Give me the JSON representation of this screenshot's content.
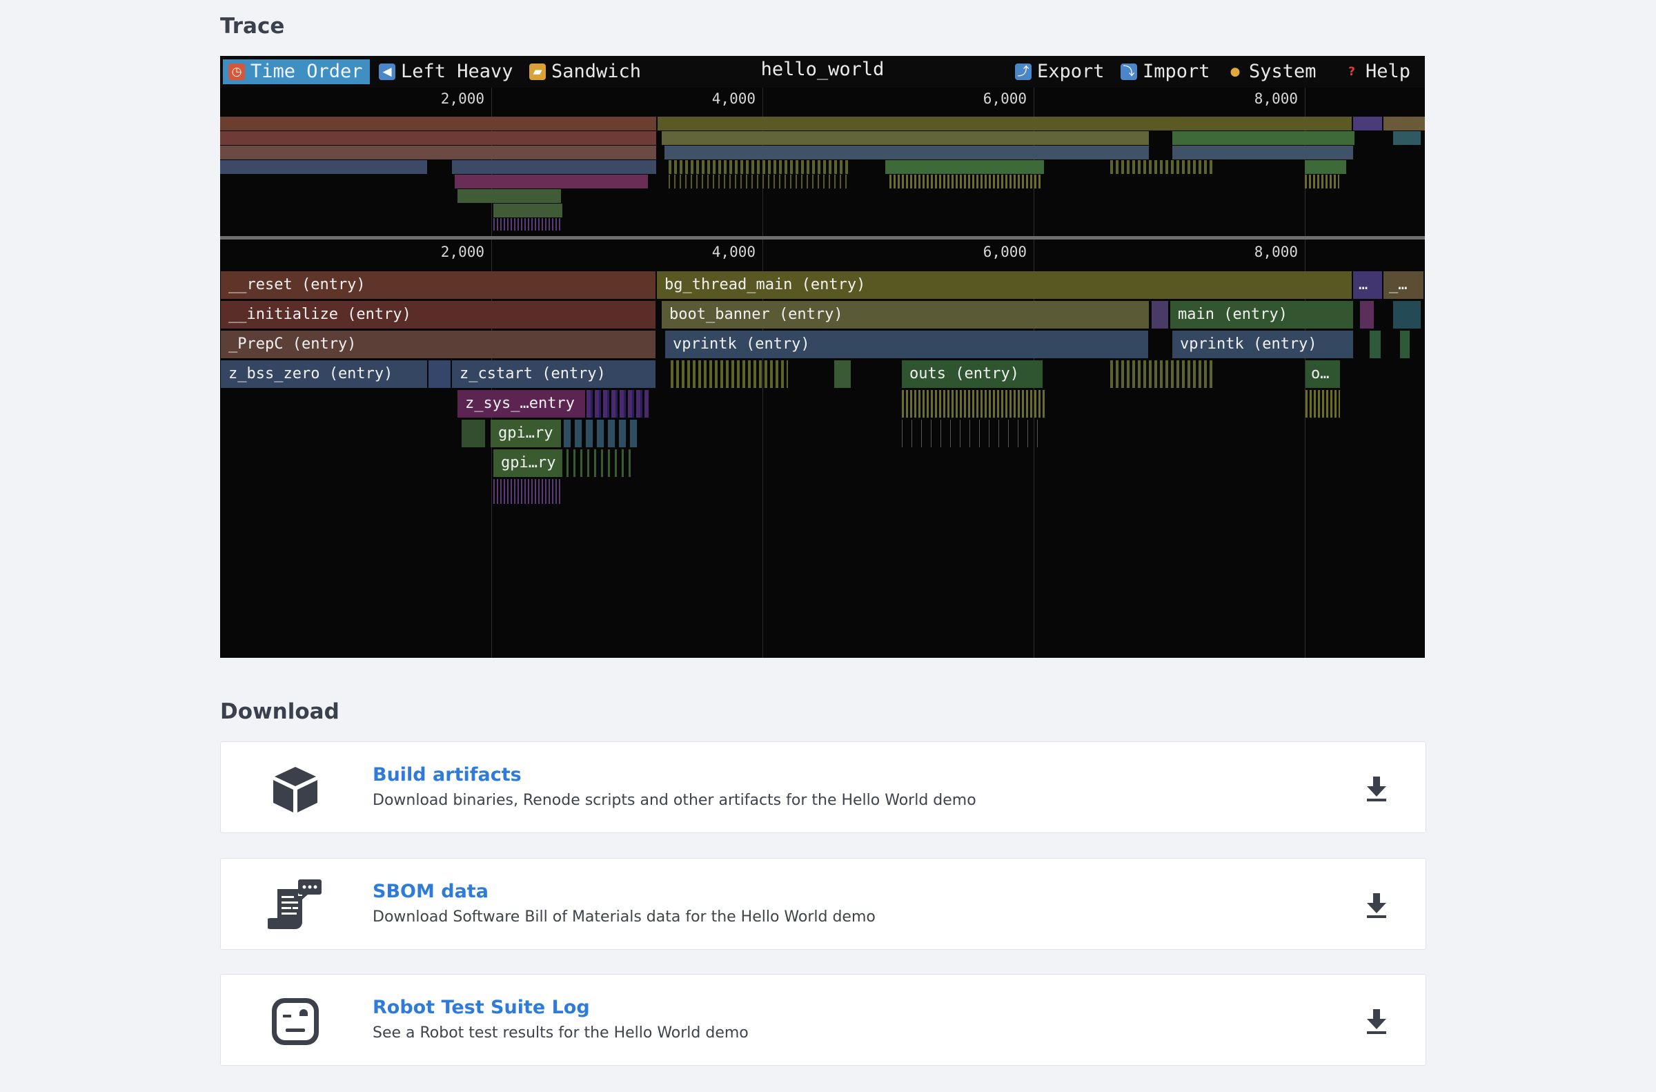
{
  "sections": {
    "trace_title": "Trace",
    "download_title": "Download"
  },
  "toolbar": {
    "tabs": [
      {
        "label": "Time Order",
        "icon": "clock-icon",
        "active": true
      },
      {
        "label": "Left Heavy",
        "icon": "arrow-left-icon",
        "active": false
      },
      {
        "label": "Sandwich",
        "icon": "sandwich-icon",
        "active": false
      }
    ],
    "profile_name": "hello_world",
    "actions": [
      {
        "label": "Export",
        "icon": "export-icon"
      },
      {
        "label": "Import",
        "icon": "import-icon"
      },
      {
        "label": "System",
        "icon": "palette-icon"
      },
      {
        "label": "Help",
        "icon": "question-icon"
      }
    ]
  },
  "axis_ticks": [
    "2,000",
    "4,000",
    "6,000",
    "8,000"
  ],
  "frames": [
    {
      "label": "__reset (entry)"
    },
    {
      "label": "bg_thread_main (entry)"
    },
    {
      "label": "…"
    },
    {
      "label": "_…"
    },
    {
      "label": "__initialize (entry)"
    },
    {
      "label": "boot_banner (entry)"
    },
    {
      "label": "main (entry)"
    },
    {
      "label": "_PrepC (entry)"
    },
    {
      "label": "vprintk (entry)"
    },
    {
      "label": "vprintk (entry)"
    },
    {
      "label": "z_bss_zero (entry)"
    },
    {
      "label": "z_cstart (entry)"
    },
    {
      "label": "outs (entry)"
    },
    {
      "label": "o…"
    },
    {
      "label": "z_sys_…entry"
    },
    {
      "label": "gpi…ry"
    },
    {
      "label": "gpi…ry"
    }
  ],
  "colors": {
    "accent": "#3f8fc3",
    "link": "#2f7bd9",
    "page_bg": "#f2f3f6"
  },
  "downloads": [
    {
      "title": "Build artifacts",
      "description": "Download binaries, Renode scripts and other artifacts for the Hello World demo",
      "icon": "cube-icon"
    },
    {
      "title": "SBOM data",
      "description": "Download Software Bill of Materials data for the Hello World demo",
      "icon": "scroll-document-icon"
    },
    {
      "title": "Robot Test Suite Log",
      "description": "See a Robot test results for the Hello World demo",
      "icon": "robot-face-icon"
    }
  ]
}
